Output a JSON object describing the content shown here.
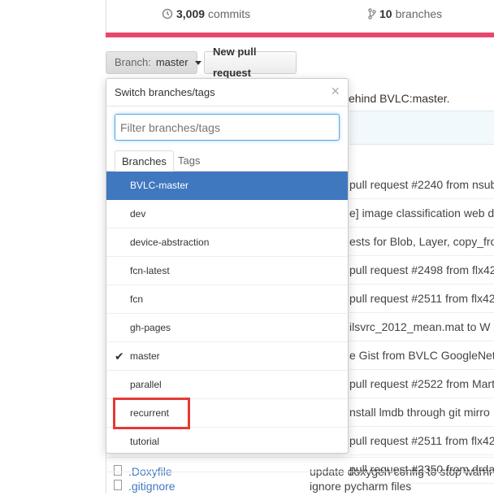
{
  "stats": {
    "commits_count": "3,009",
    "commits_label": "commits",
    "branches_count": "10",
    "branches_label": "branches"
  },
  "toolbar": {
    "branch_prefix": "Branch:",
    "branch_value": "master",
    "pull_request_label": "New pull request"
  },
  "behind_text": "ehind BVLC:master.",
  "dropdown": {
    "title": "Switch branches/tags",
    "close": "×",
    "filter_placeholder": "Filter branches/tags",
    "tabs": [
      "Branches",
      "Tags"
    ],
    "items": [
      {
        "label": "BVLC-master"
      },
      {
        "label": "dev"
      },
      {
        "label": "device-abstraction"
      },
      {
        "label": "fcn-latest"
      },
      {
        "label": "fcn"
      },
      {
        "label": "gh-pages"
      },
      {
        "label": "master",
        "check": "✔"
      },
      {
        "label": "parallel"
      },
      {
        "label": "recurrent"
      },
      {
        "label": "tutorial"
      }
    ]
  },
  "commits": [
    "pull request #2240 from nsub",
    "e] image classification web d",
    "ests for Blob, Layer, copy_from",
    "pull request #2498 from flx42",
    "pull request #2511 from flx42",
    "ilsvrc_2012_mean.mat to W x",
    "e Gist from BVLC GoogleNet",
    "pull request #2522 from Mart",
    "nstall lmdb through git mirro",
    "pull request #2511 from flx42",
    "pull request #2350 from drda"
  ],
  "files": [
    {
      "name": ".Doxyfile",
      "message": "update doxygen config to stop warni"
    },
    {
      "name": ".gitignore",
      "message": "ignore pycharm files"
    }
  ],
  "colors": {
    "accent": "#4078c0",
    "language_bar": "#e8476c",
    "highlight": "#e53935"
  }
}
